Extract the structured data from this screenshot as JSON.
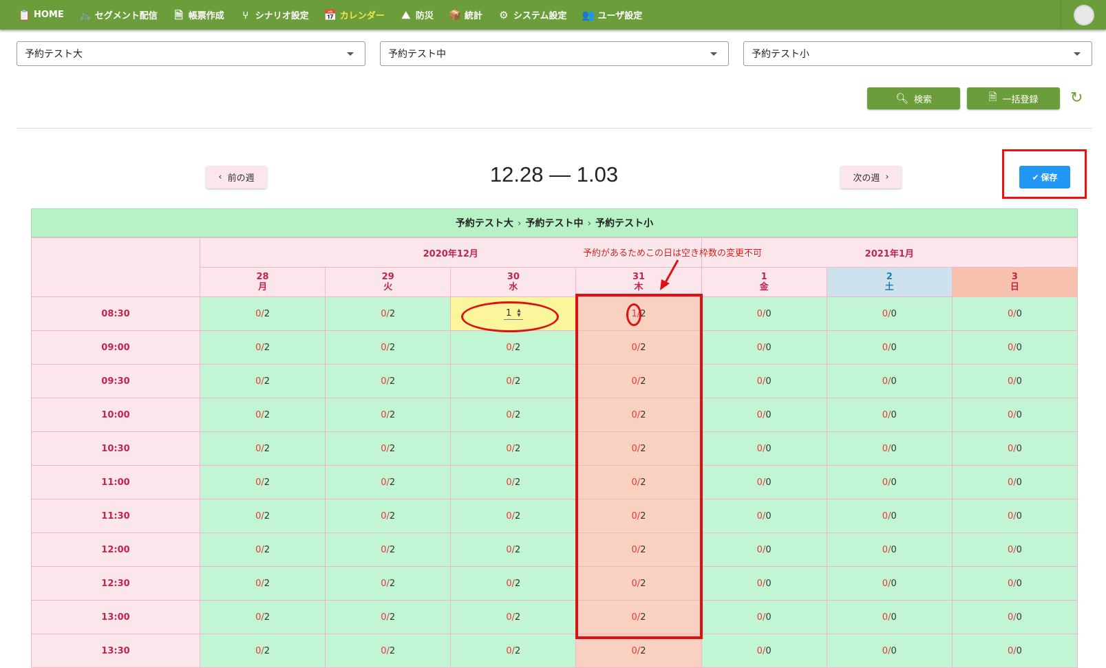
{
  "nav": {
    "items": [
      {
        "label": "HOME",
        "icon": "clipboard-icon"
      },
      {
        "label": "セグメント配信",
        "icon": "bicycle-icon"
      },
      {
        "label": "帳票作成",
        "icon": "document-icon"
      },
      {
        "label": "シナリオ設定",
        "icon": "tree-icon"
      },
      {
        "label": "カレンダー",
        "icon": "calendar-icon"
      },
      {
        "label": "防災",
        "icon": "mountain-icon"
      },
      {
        "label": "統計",
        "icon": "box-icon"
      },
      {
        "label": "システム設定",
        "icon": "gear-icon"
      },
      {
        "label": "ユーザ設定",
        "icon": "users-icon"
      }
    ],
    "active_index": 4
  },
  "filters": {
    "large": {
      "value": "予約テスト大"
    },
    "medium": {
      "value": "予約テスト中"
    },
    "small": {
      "value": "予約テスト小"
    }
  },
  "actions": {
    "search_label": "検索",
    "bulk_label": "一括登録"
  },
  "week": {
    "prev_label": "前の週",
    "next_label": "次の週",
    "range": "12.28 — 1.03",
    "save_label": "保存"
  },
  "calendar": {
    "breadcrumb": [
      "予約テスト大",
      "予約テスト中",
      "予約テスト小"
    ],
    "months": [
      {
        "label": "2020年12月",
        "span": 4
      },
      {
        "label": "2021年1月",
        "span": 3
      }
    ],
    "days": [
      {
        "day": "28",
        "weekday": "月",
        "type": "weekday"
      },
      {
        "day": "29",
        "weekday": "火",
        "type": "weekday"
      },
      {
        "day": "30",
        "weekday": "水",
        "type": "weekday"
      },
      {
        "day": "31",
        "weekday": "木",
        "type": "weekday"
      },
      {
        "day": "1",
        "weekday": "金",
        "type": "weekday"
      },
      {
        "day": "2",
        "weekday": "土",
        "type": "sat"
      },
      {
        "day": "3",
        "weekday": "日",
        "type": "sun"
      }
    ],
    "times": [
      "08:30",
      "09:00",
      "09:30",
      "10:00",
      "10:30",
      "11:00",
      "11:30",
      "12:00",
      "12:30",
      "13:00",
      "13:30"
    ],
    "rows": [
      [
        [
          "0",
          "2"
        ],
        [
          "0",
          "2"
        ],
        [
          "1",
          "edit"
        ],
        [
          "1",
          "2"
        ],
        [
          "0",
          "0"
        ],
        [
          "0",
          "0"
        ],
        [
          "0",
          "0"
        ]
      ],
      [
        [
          "0",
          "2"
        ],
        [
          "0",
          "2"
        ],
        [
          "0",
          "2"
        ],
        [
          "0",
          "2"
        ],
        [
          "0",
          "0"
        ],
        [
          "0",
          "0"
        ],
        [
          "0",
          "0"
        ]
      ],
      [
        [
          "0",
          "2"
        ],
        [
          "0",
          "2"
        ],
        [
          "0",
          "2"
        ],
        [
          "0",
          "2"
        ],
        [
          "0",
          "0"
        ],
        [
          "0",
          "0"
        ],
        [
          "0",
          "0"
        ]
      ],
      [
        [
          "0",
          "2"
        ],
        [
          "0",
          "2"
        ],
        [
          "0",
          "2"
        ],
        [
          "0",
          "2"
        ],
        [
          "0",
          "0"
        ],
        [
          "0",
          "0"
        ],
        [
          "0",
          "0"
        ]
      ],
      [
        [
          "0",
          "2"
        ],
        [
          "0",
          "2"
        ],
        [
          "0",
          "2"
        ],
        [
          "0",
          "2"
        ],
        [
          "0",
          "0"
        ],
        [
          "0",
          "0"
        ],
        [
          "0",
          "0"
        ]
      ],
      [
        [
          "0",
          "2"
        ],
        [
          "0",
          "2"
        ],
        [
          "0",
          "2"
        ],
        [
          "0",
          "2"
        ],
        [
          "0",
          "0"
        ],
        [
          "0",
          "0"
        ],
        [
          "0",
          "0"
        ]
      ],
      [
        [
          "0",
          "2"
        ],
        [
          "0",
          "2"
        ],
        [
          "0",
          "2"
        ],
        [
          "0",
          "2"
        ],
        [
          "0",
          "0"
        ],
        [
          "0",
          "0"
        ],
        [
          "0",
          "0"
        ]
      ],
      [
        [
          "0",
          "2"
        ],
        [
          "0",
          "2"
        ],
        [
          "0",
          "2"
        ],
        [
          "0",
          "2"
        ],
        [
          "0",
          "0"
        ],
        [
          "0",
          "0"
        ],
        [
          "0",
          "0"
        ]
      ],
      [
        [
          "0",
          "2"
        ],
        [
          "0",
          "2"
        ],
        [
          "0",
          "2"
        ],
        [
          "0",
          "2"
        ],
        [
          "0",
          "0"
        ],
        [
          "0",
          "0"
        ],
        [
          "0",
          "0"
        ]
      ],
      [
        [
          "0",
          "2"
        ],
        [
          "0",
          "2"
        ],
        [
          "0",
          "2"
        ],
        [
          "0",
          "2"
        ],
        [
          "0",
          "0"
        ],
        [
          "0",
          "0"
        ],
        [
          "0",
          "0"
        ]
      ],
      [
        [
          "0",
          "2"
        ],
        [
          "0",
          "2"
        ],
        [
          "0",
          "2"
        ],
        [
          "0",
          "2"
        ],
        [
          "0",
          "0"
        ],
        [
          "0",
          "0"
        ],
        [
          "0",
          "0"
        ]
      ]
    ],
    "reserved_day_index": 3,
    "stepper_value": "1"
  },
  "annotation": {
    "text": "予約があるためこの日は空き枠数の変更不可"
  },
  "colors": {
    "nav": "#6b9e3a",
    "active_nav": "#f2e64a",
    "open_slot": "#c1f5d3",
    "reserved_day": "#f9d1c1",
    "editing": "#fbf59b",
    "annotation": "#dd1111",
    "save": "#2196f3"
  }
}
